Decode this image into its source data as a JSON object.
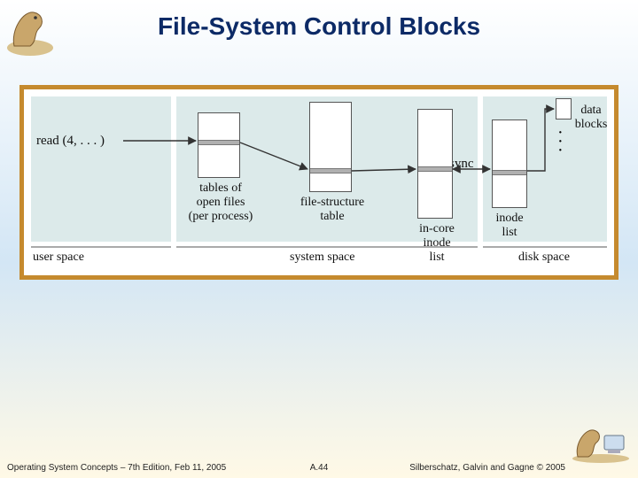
{
  "title": "File-System Control Blocks",
  "diagram": {
    "read_call": "read (4, . . . )",
    "sync_label": "sync",
    "regions": {
      "user": "user space",
      "system": "system space",
      "disk": "disk space"
    },
    "captions": {
      "open_files": "tables of\nopen files\n(per process)",
      "file_structure": "file-structure\ntable",
      "incore_inode": "in-core\ninode\nlist",
      "inode_list": "inode\nlist",
      "data_blocks": "data\nblocks"
    }
  },
  "footer": {
    "left": "Operating System Concepts – 7th Edition, Feb 11, 2005",
    "center": "A.44",
    "right": "Silberschatz, Galvin and Gagne © 2005"
  }
}
